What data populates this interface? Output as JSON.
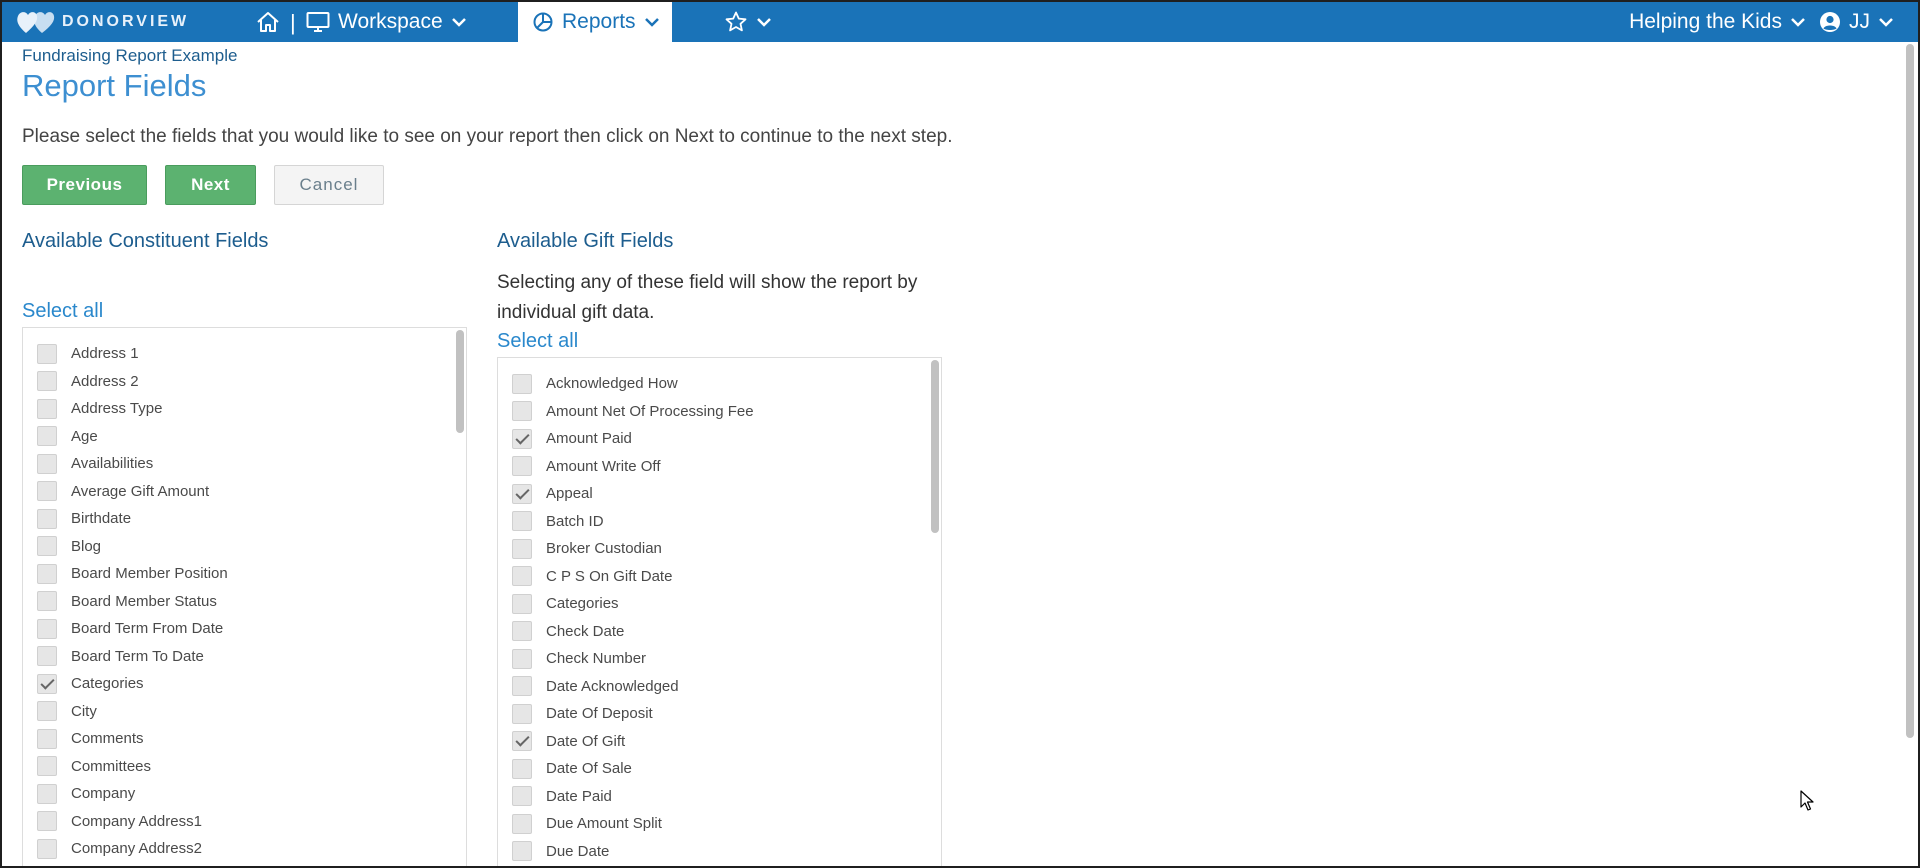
{
  "nav": {
    "brand": "DONORVIEW",
    "separator": "|",
    "workspace": "Workspace",
    "reports": "Reports",
    "organization": "Helping the Kids",
    "user_initials": "JJ",
    "icons": [
      "logo-hearts-icon",
      "home-icon",
      "monitor-icon",
      "pie-chart-icon",
      "star-icon",
      "chevron-down-icon",
      "user-circle-icon"
    ],
    "bar_color": "#1a73b8"
  },
  "page": {
    "report_name": "Fundraising Report Example",
    "title": "Report Fields",
    "instructions": "Please select the fields that you would like to see on your report then click on Next to continue to the next step."
  },
  "buttons": {
    "previous": "Previous",
    "next": "Next",
    "cancel": "Cancel"
  },
  "constituent": {
    "heading": "Available Constituent Fields",
    "select_all": "Select all",
    "fields": [
      {
        "label": "Address 1",
        "checked": false
      },
      {
        "label": "Address 2",
        "checked": false
      },
      {
        "label": "Address Type",
        "checked": false
      },
      {
        "label": "Age",
        "checked": false
      },
      {
        "label": "Availabilities",
        "checked": false
      },
      {
        "label": "Average Gift Amount",
        "checked": false
      },
      {
        "label": "Birthdate",
        "checked": false
      },
      {
        "label": "Blog",
        "checked": false
      },
      {
        "label": "Board Member Position",
        "checked": false
      },
      {
        "label": "Board Member Status",
        "checked": false
      },
      {
        "label": "Board Term From Date",
        "checked": false
      },
      {
        "label": "Board Term To Date",
        "checked": false
      },
      {
        "label": "Categories",
        "checked": true
      },
      {
        "label": "City",
        "checked": false
      },
      {
        "label": "Comments",
        "checked": false
      },
      {
        "label": "Committees",
        "checked": false
      },
      {
        "label": "Company",
        "checked": false
      },
      {
        "label": "Company Address1",
        "checked": false
      },
      {
        "label": "Company Address2",
        "checked": false
      }
    ]
  },
  "gift": {
    "heading": "Available Gift Fields",
    "description": "Selecting any of these field will show the report by individual gift data.",
    "select_all": "Select all",
    "fields": [
      {
        "label": "Acknowledged How",
        "checked": false
      },
      {
        "label": "Amount Net Of Processing Fee",
        "checked": false
      },
      {
        "label": "Amount Paid",
        "checked": true
      },
      {
        "label": "Amount Write Off",
        "checked": false
      },
      {
        "label": "Appeal",
        "checked": true
      },
      {
        "label": "Batch ID",
        "checked": false
      },
      {
        "label": "Broker Custodian",
        "checked": false
      },
      {
        "label": "C P S On Gift Date",
        "checked": false
      },
      {
        "label": "Categories",
        "checked": false
      },
      {
        "label": "Check Date",
        "checked": false
      },
      {
        "label": "Check Number",
        "checked": false
      },
      {
        "label": "Date Acknowledged",
        "checked": false
      },
      {
        "label": "Date Of Deposit",
        "checked": false
      },
      {
        "label": "Date Of Gift",
        "checked": true
      },
      {
        "label": "Date Of Sale",
        "checked": false
      },
      {
        "label": "Date Paid",
        "checked": false
      },
      {
        "label": "Due Amount Split",
        "checked": false
      },
      {
        "label": "Due Date",
        "checked": false
      }
    ]
  }
}
